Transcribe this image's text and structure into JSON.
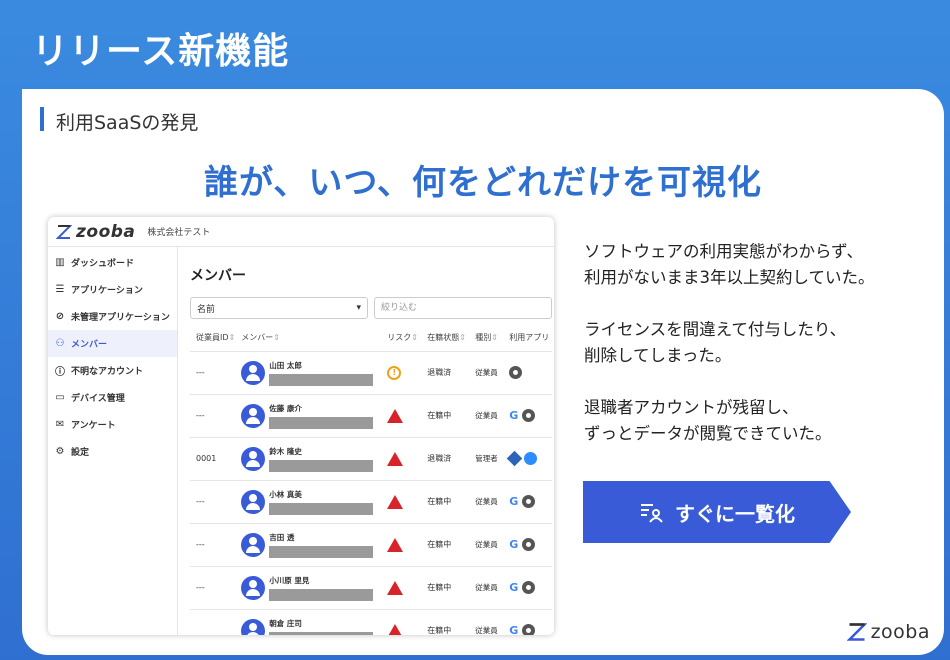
{
  "slide": {
    "title": "リリース新機能",
    "section": "利用SaaSの発見",
    "headline": "誰が、いつ、何をどれだけを可視化"
  },
  "app": {
    "logo": "zooba",
    "company": "株式会社テスト",
    "sidebar": [
      {
        "label": "ダッシュボード",
        "icon": "chart-icon",
        "active": false
      },
      {
        "label": "アプリケーション",
        "icon": "list-icon",
        "active": false
      },
      {
        "label": "未管理アプリケーション",
        "icon": "eye-off-icon",
        "active": false
      },
      {
        "label": "メンバー",
        "icon": "users-icon",
        "active": true
      },
      {
        "label": "不明なアカウント",
        "icon": "alert-circle-icon",
        "active": false
      },
      {
        "label": "デバイス管理",
        "icon": "device-icon",
        "active": false
      },
      {
        "label": "アンケート",
        "icon": "mail-icon",
        "active": false
      },
      {
        "label": "設定",
        "icon": "gear-icon",
        "active": false
      }
    ],
    "page_title": "メンバー",
    "filter_select": "名前",
    "search_placeholder": "絞り込む",
    "columns": [
      "従業員ID",
      "メンバー",
      "リスク",
      "在籍状態",
      "種別",
      "利用アプリ"
    ],
    "rows": [
      {
        "id": "---",
        "name": "山田 太郎",
        "risk": "warning",
        "status": "退職済",
        "type": "従業員",
        "apps": [
          "gear"
        ]
      },
      {
        "id": "---",
        "name": "佐藤 康介",
        "risk": "danger",
        "status": "在籍中",
        "type": "従業員",
        "apps": [
          "google",
          "gear"
        ]
      },
      {
        "id": "0001",
        "name": "鈴木 隆史",
        "risk": "danger",
        "status": "退職済",
        "type": "管理者",
        "apps": [
          "diamond",
          "zoom"
        ]
      },
      {
        "id": "---",
        "name": "小林 真美",
        "risk": "danger",
        "status": "在籍中",
        "type": "従業員",
        "apps": [
          "google",
          "gear"
        ]
      },
      {
        "id": "---",
        "name": "吉田 透",
        "risk": "danger",
        "status": "在籍中",
        "type": "従業員",
        "apps": [
          "google",
          "gear"
        ]
      },
      {
        "id": "---",
        "name": "小川原 里見",
        "risk": "danger",
        "status": "在籍中",
        "type": "従業員",
        "apps": [
          "google",
          "gear"
        ]
      },
      {
        "id": "",
        "name": "朝倉 庄司",
        "risk": "danger",
        "status": "在籍中",
        "type": "従業員",
        "apps": [
          "google",
          "gear"
        ]
      }
    ]
  },
  "desc": {
    "p1": [
      "ソフトウェアの利用実態がわからず、",
      "利用がないまま3年以上契約していた。"
    ],
    "p2": [
      "ライセンスを間違えて付与したり、",
      "削除してしまった。"
    ],
    "p3": [
      "退職者アカウントが残留し、",
      "ずっとデータが閲覧できていた。"
    ]
  },
  "cta_label": "すぐに一覧化",
  "footer_logo": "zooba",
  "colors": {
    "primary": "#3a5bd8",
    "accent": "#2f6fd0"
  }
}
